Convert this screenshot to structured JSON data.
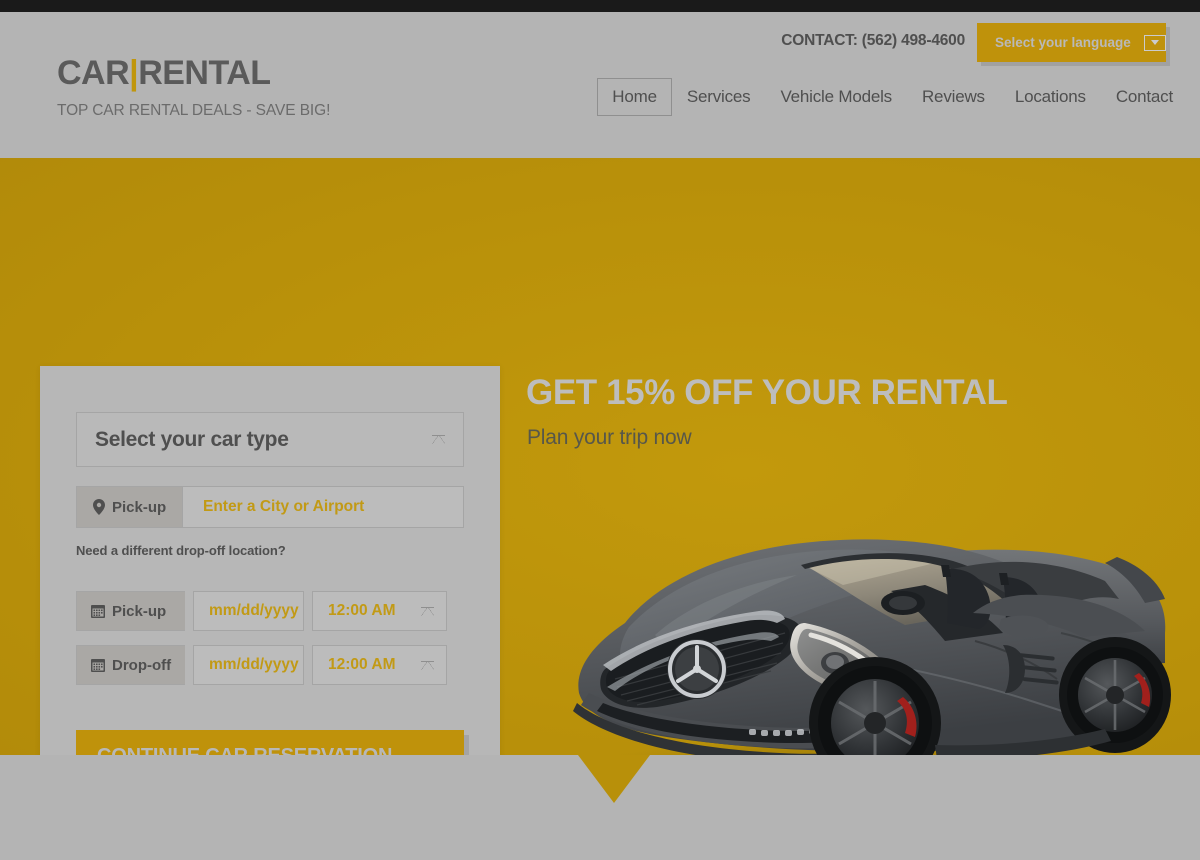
{
  "topbar": {
    "color": "#1a1a1a"
  },
  "header": {
    "brand": {
      "part1": "CAR",
      "separator": "|",
      "part2": "RENTAL",
      "tagline": "TOP CAR RENTAL DEALS - SAVE BIG!"
    },
    "contact": "CONTACT: (562) 498-4600",
    "language_button": {
      "label": "Select your language",
      "caret_icon": "caret-down-icon"
    },
    "nav": [
      {
        "label": "Home",
        "active": true
      },
      {
        "label": "Services",
        "active": false
      },
      {
        "label": "Vehicle Models",
        "active": false
      },
      {
        "label": "Reviews",
        "active": false
      },
      {
        "label": "Locations",
        "active": false
      },
      {
        "label": "Contact",
        "active": false
      }
    ]
  },
  "hero": {
    "title": "GET 15% OFF YOUR RENTAL",
    "subtitle": "Plan your trip now",
    "background_color": "#b8900a",
    "car_image_alt": "dark gray Mercedes-Benz SL convertible",
    "carousel": {
      "prev": "‹",
      "next": "›"
    }
  },
  "booking": {
    "car_type": {
      "label": "Select your car type",
      "chevron_icon": "chevron-down-icon"
    },
    "pickup_location": {
      "tag": "Pick-up",
      "icon": "map-pin-icon",
      "placeholder": "Enter a City or Airport",
      "value": ""
    },
    "dropoff_link": "Need a different drop-off location?",
    "pickup_date": {
      "tag": "Pick-up",
      "icon": "calendar-icon",
      "date_placeholder": "mm/dd/yyyy",
      "time_value": "12:00 AM",
      "chevron_icon": "chevron-down-icon"
    },
    "dropoff_date": {
      "tag": "Drop-off",
      "icon": "calendar-icon",
      "date_placeholder": "mm/dd/yyyy",
      "time_value": "12:00 AM",
      "chevron_icon": "chevron-down-icon"
    },
    "submit_label": "CONTINUE CAR RESERVATION"
  },
  "colors": {
    "gold": "#b8900a",
    "gold_button": "#bf920b",
    "gray_bg": "#b4b4b4",
    "text_dark": "#4f4f4f",
    "accent_text": "#c29a15"
  }
}
